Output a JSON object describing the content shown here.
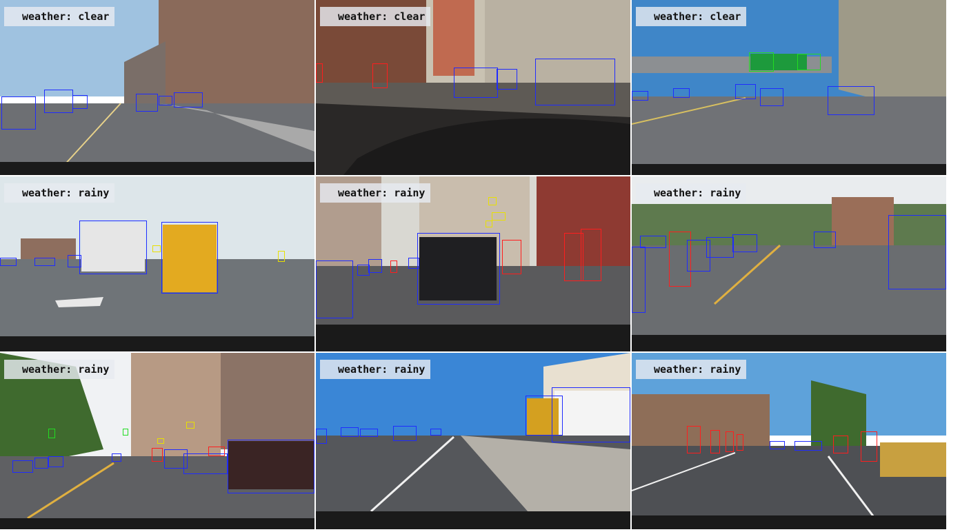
{
  "panels": [
    {
      "label": "weather: clear",
      "sky": "#9fc2e0",
      "ground": "#6d6f73"
    },
    {
      "label": "weather: clear",
      "sky": "#c9c2b2",
      "ground": "#5e5a55"
    },
    {
      "label": "weather: clear",
      "sky": "#3f86c8",
      "ground": "#707276"
    },
    {
      "label": "weather: rainy",
      "sky": "#dde6ea",
      "ground": "#6f7478"
    },
    {
      "label": "weather: rainy",
      "sky": "#d9d8d2",
      "ground": "#5a5a5c"
    },
    {
      "label": "weather: rainy",
      "sky": "#e9ecee",
      "ground": "#6a6d70"
    },
    {
      "label": "weather: rainy",
      "sky": "#f0f2f4",
      "ground": "#5f6063"
    },
    {
      "label": "weather: rainy",
      "sky": "#3a86d6",
      "ground": "#55575b"
    },
    {
      "label": "weather: rainy",
      "sky": "#5ea2da",
      "ground": "#4e5054"
    }
  ],
  "colors": {
    "car_box": "#1f2bff",
    "pedestrian_box": "#ff1e1e",
    "traffic_light_box": "#e8e000",
    "traffic_sign_box": "#22dd22"
  }
}
